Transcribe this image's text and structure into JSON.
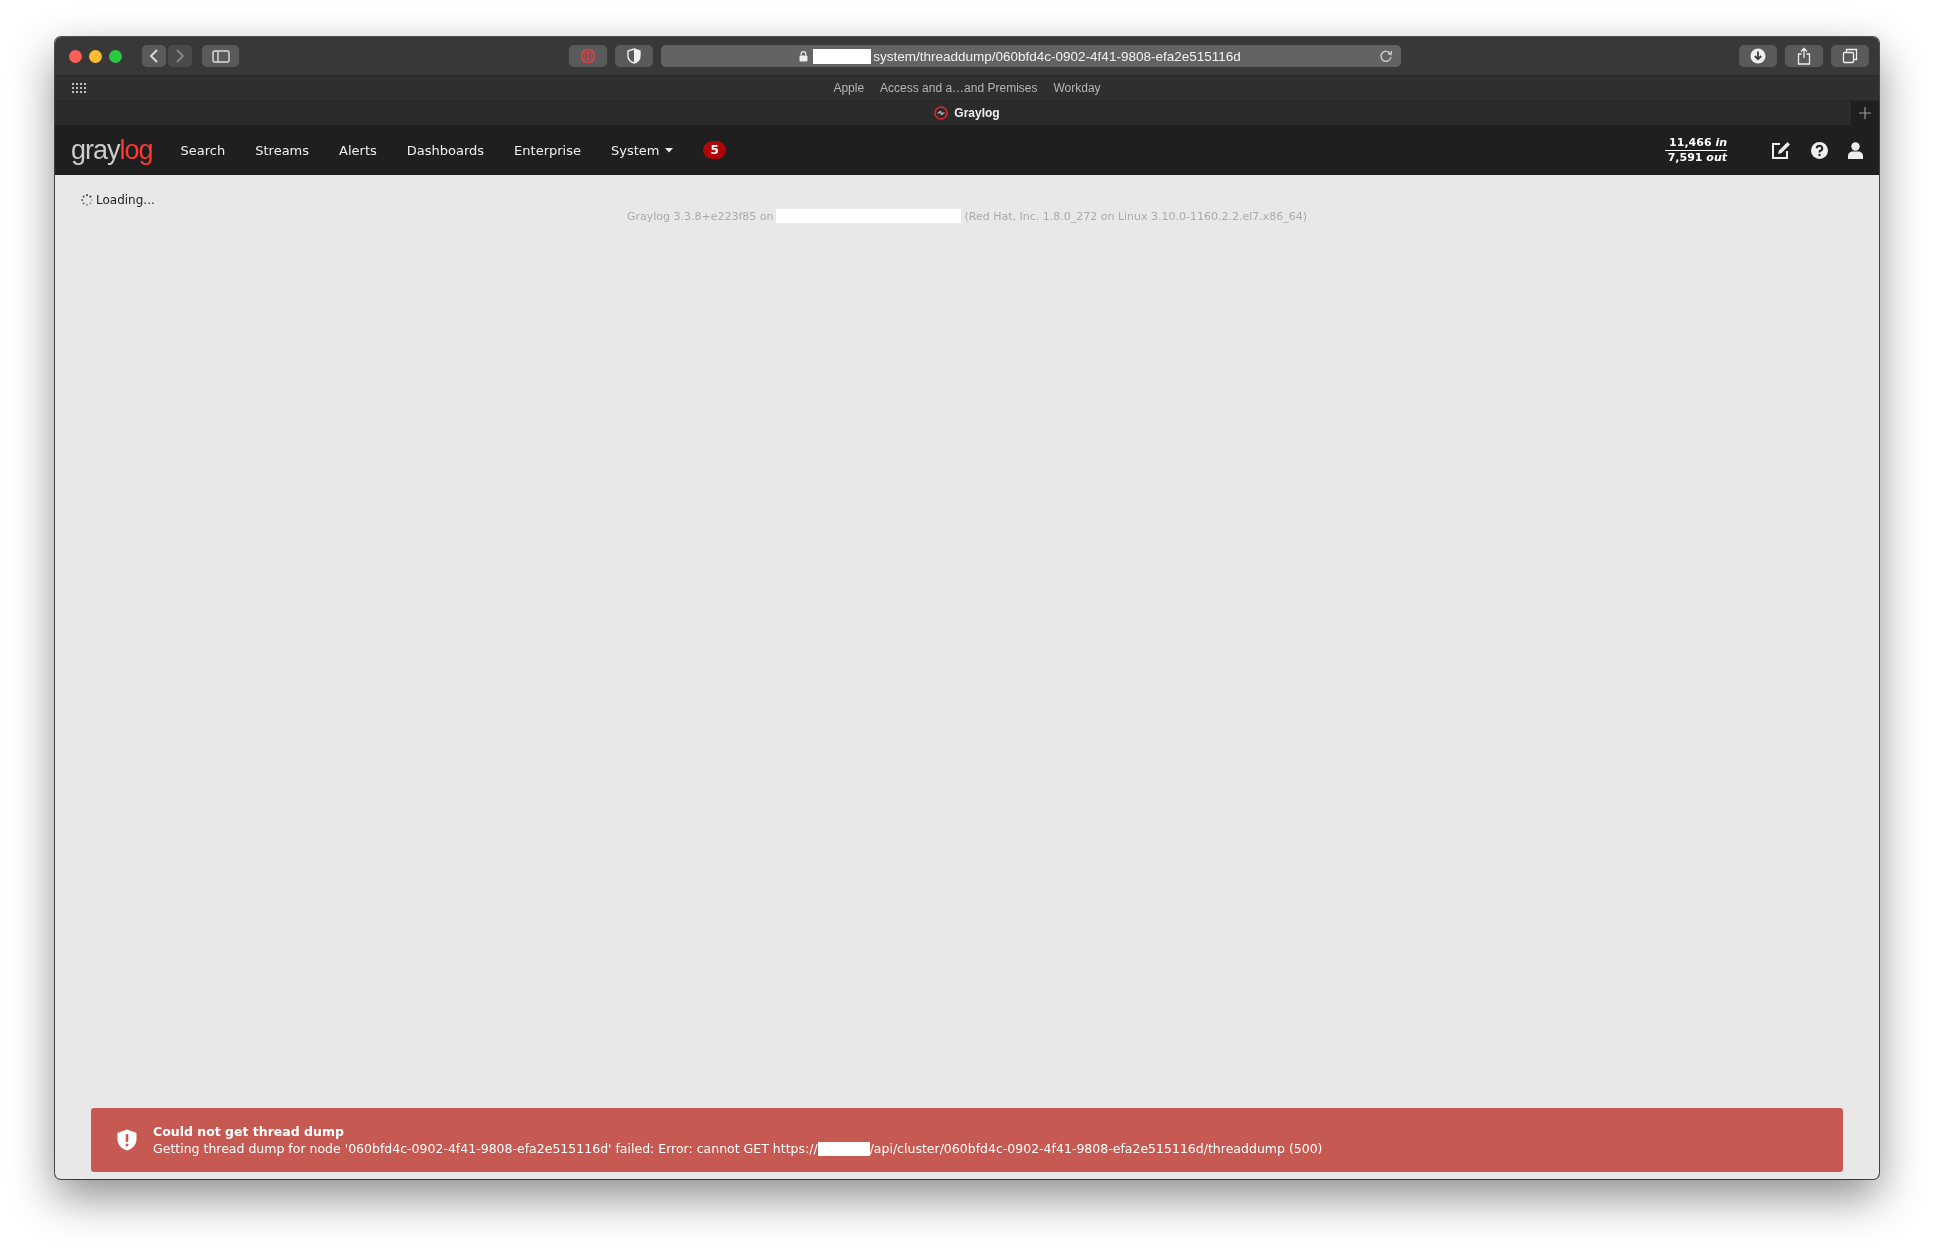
{
  "browser": {
    "url": "system/threaddump/060bfd4c-0902-4f41-9808-efa2e515116d",
    "bookmarks": [
      "Apple",
      "Access and a…and Premises",
      "Workday"
    ],
    "tab": {
      "title": "Graylog"
    }
  },
  "navbar": {
    "logo": [
      "gray",
      "log"
    ],
    "items": [
      {
        "label": "Search",
        "kind": "link"
      },
      {
        "label": "Streams",
        "kind": "link"
      },
      {
        "label": "Alerts",
        "kind": "link"
      },
      {
        "label": "Dashboards",
        "kind": "link"
      },
      {
        "label": "Enterprise",
        "kind": "link"
      },
      {
        "label": "System",
        "kind": "dropdown"
      }
    ],
    "badge": "5",
    "throughput": {
      "incoming": "11,466 *in*",
      "outgoing": "7,591 *out*"
    }
  },
  "content": {
    "loading": "Loading...",
    "footer": [
      "Graylog 3.3.8+e223f85 on",
      "(Red Hat, Inc. 1.8.0_272 on Linux 3.10.0-1160.2.2.el7.x86_64)"
    ]
  },
  "alert": {
    "title": "Could not get thread dump",
    "message": [
      "Getting thread dump for node '060bfd4c-0902-4f41-9808-efa2e515116d' failed: Error: cannot GET https://",
      "/api/cluster/060bfd4c-0902-4f41-9808-efa2e515116d/threaddump (500)"
    ]
  }
}
